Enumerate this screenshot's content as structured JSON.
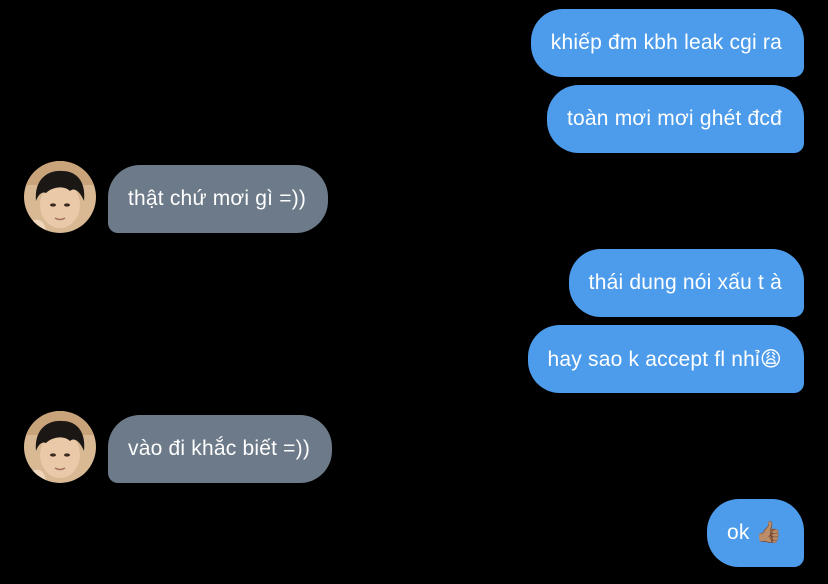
{
  "chat": {
    "messages": [
      {
        "direction": "sent",
        "text": "khiếp đm kbh leak cgi ra"
      },
      {
        "direction": "sent",
        "text": "toàn mơi mơi ghét đcđ"
      },
      {
        "direction": "received",
        "text": "thật chứ mơi gì =))"
      },
      {
        "direction": "sent",
        "text": "thái dung nói xấu t à"
      },
      {
        "direction": "sent",
        "text": "hay sao k accept fl nhỉ😩"
      },
      {
        "direction": "received",
        "text": "vào đi khắc biết =))"
      },
      {
        "direction": "sent",
        "text": "ok 👍🏽"
      }
    ]
  },
  "colors": {
    "background": "#000000",
    "sent_bubble": "#4d9ceb",
    "received_bubble": "#6c7a89",
    "text": "#ffffff"
  }
}
